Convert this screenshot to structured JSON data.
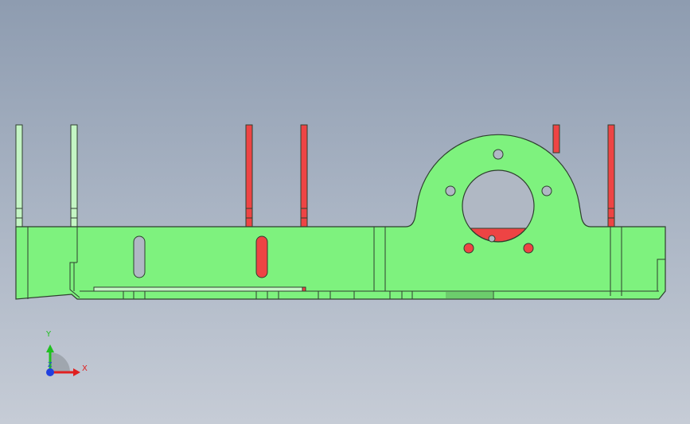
{
  "viewport": {
    "background_top": "#8e9cb0",
    "background_bottom": "#c6ccd6"
  },
  "colors": {
    "part_green": "#7ef27e",
    "part_light_green": "#c4f5c4",
    "selected_red": "#ee4444",
    "edge": "#2f3f2f",
    "axis_x": "#e02020",
    "axis_y": "#20c020",
    "axis_z": "#2040e0"
  },
  "triad": {
    "x_label": "X",
    "y_label": "Y",
    "z_label": "Z"
  }
}
